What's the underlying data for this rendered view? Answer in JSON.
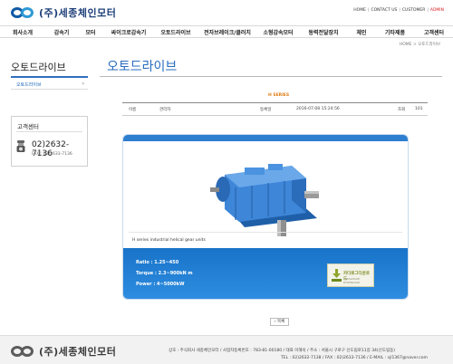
{
  "header": {
    "logo_text": "(주)세종체인모터",
    "toplinks": [
      "HOME",
      "CONTACT US",
      "CUSTOMER",
      "ADMIN"
    ]
  },
  "gnb": [
    "회사소개",
    "감속기",
    "모터",
    "싸이크로감속기",
    "오토드라이브",
    "전자브레이크/클러치",
    "소형감속모터",
    "동력전달장치",
    "체인",
    "기타제품",
    "고객센터"
  ],
  "breadcrumb": "HOME > 오토드라이브",
  "sidebar": {
    "title": "오토드라이브",
    "menu_item": "오토드라이브",
    "customer_center": {
      "title": "고객센터",
      "phone": "02)2632-7136",
      "fax": "FAX : 02)2633-7136"
    }
  },
  "content": {
    "page_title": "오토드라이브",
    "board_category": "H SERIES",
    "meta": {
      "name_label": "이름",
      "name_value": "관리자",
      "date_label": "등록일",
      "date_value": "2016-07-08 15:24:56",
      "views_label": "조회",
      "views_value": "101"
    },
    "caption": "H series industrial helical gear units",
    "specs": [
      "Ratio : 1.25~450",
      "Torque : 2.3~900kN m",
      "Power : 4~5000kW"
    ],
    "catalog_button": {
      "label": "카다로그다운로드",
      "sub": "CATALOGUE DOWNLOAD"
    },
    "list_button": "목록"
  },
  "footer": {
    "logo_text": "(주)세종체인모터",
    "line1": "상호 : 주식회사 세종체인모터 / 사업자등록번호 : 783-81-00180 / 대표 이해욱 / 주소 : 서울시 구로구 신도림로11길 34(신도림동)",
    "line2": "TEL : 02)2632-7138 / FAX : 02)2633-7136 / E-MAIL : sjl1367@naver.com"
  },
  "colors": {
    "brand_blue": "#2a6cbf",
    "spec_bg": "#1873c9",
    "admin_red": "#d72020",
    "category_orange": "#e07c14"
  }
}
